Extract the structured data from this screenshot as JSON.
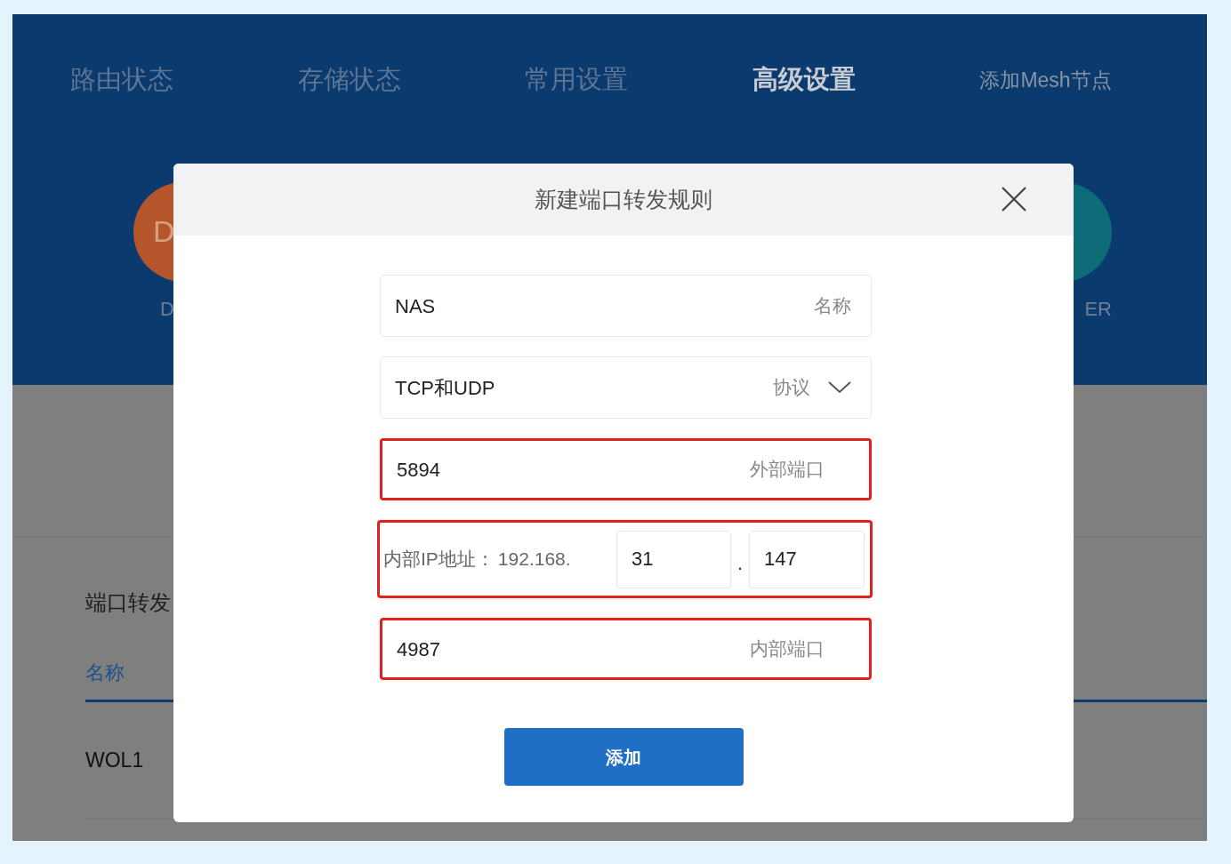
{
  "nav": [
    {
      "label": "路由状态",
      "selected": false
    },
    {
      "label": "存储状态",
      "selected": false
    },
    {
      "label": "常用设置",
      "selected": false
    },
    {
      "label": "高级设置",
      "selected": true
    },
    {
      "label": "添加Mesh节点",
      "selected": false
    }
  ],
  "app_tiles": [
    {
      "glyph": "D",
      "label": "D",
      "color": "#b4552c"
    },
    {
      "label": "ER",
      "color": "#0e6b78"
    }
  ],
  "section": {
    "title": "端口转发",
    "column": "名称",
    "rows": [
      "WOL1"
    ]
  },
  "dialog": {
    "title": "新建端口转发规则",
    "fields": [
      {
        "kind": "text",
        "value": "NAS",
        "label": "名称",
        "highlighted": false
      },
      {
        "kind": "select",
        "value": "TCP和UDP",
        "label": "协议",
        "highlighted": false
      },
      {
        "kind": "text",
        "value": "5894",
        "label": "外部端口",
        "highlighted": true
      },
      {
        "kind": "ip",
        "label": "内部IP地址：",
        "prefix": "192.168.",
        "octets": [
          "31",
          "147"
        ],
        "separator": ".",
        "highlighted": true
      },
      {
        "kind": "text",
        "value": "4987",
        "label": "内部端口",
        "highlighted": true
      }
    ],
    "button": "添加"
  }
}
